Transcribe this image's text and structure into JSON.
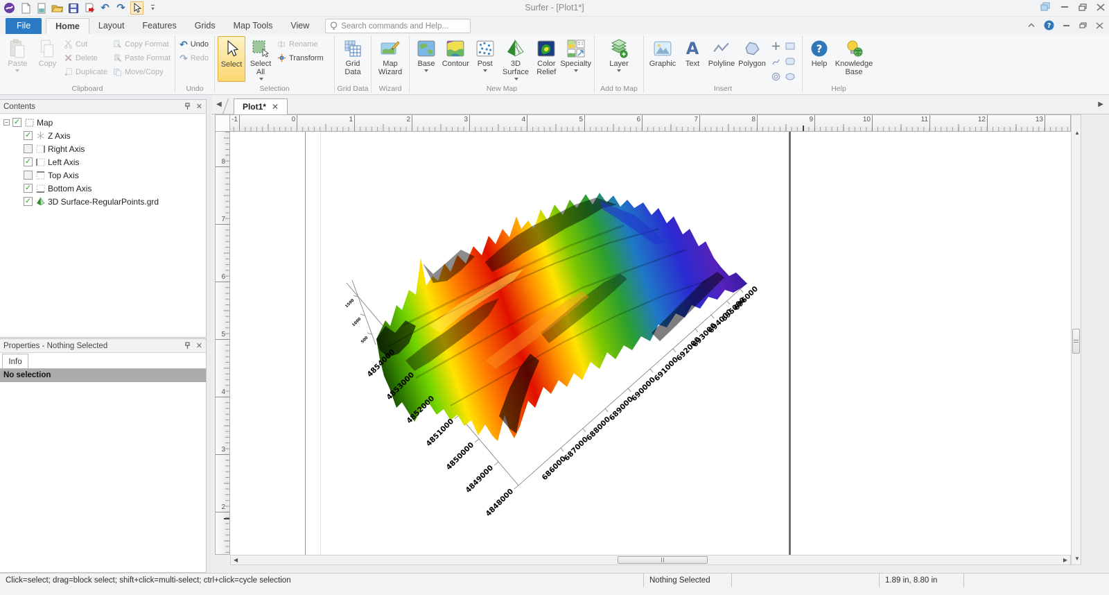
{
  "window": {
    "title": "Surfer - [Plot1*]"
  },
  "ribbon_tabs": {
    "file": "File",
    "home": "Home",
    "layout": "Layout",
    "features": "Features",
    "grids": "Grids",
    "map_tools": "Map Tools",
    "view": "View"
  },
  "search": {
    "placeholder": "Search commands and Help..."
  },
  "ribbon": {
    "clipboard": {
      "label": "Clipboard",
      "paste": "Paste",
      "copy": "Copy",
      "cut": "Cut",
      "delete": "Delete",
      "duplicate": "Duplicate",
      "copy_format": "Copy Format",
      "paste_format": "Paste Format",
      "move_copy": "Move/Copy"
    },
    "undo_group": {
      "label": "Undo",
      "undo": "Undo",
      "redo": "Redo"
    },
    "selection": {
      "label": "Selection",
      "select": "Select",
      "select_all": "Select All",
      "rename": "Rename",
      "transform": "Transform"
    },
    "grid_data": {
      "label": "Grid Data",
      "grid_data": "Grid Data"
    },
    "wizard": {
      "label": "Wizard",
      "map_wizard": "Map Wizard"
    },
    "new_map": {
      "label": "New Map",
      "base": "Base",
      "contour": "Contour",
      "post": "Post",
      "surface_3d": "3D Surface",
      "color_relief": "Color Relief",
      "specialty": "Specialty"
    },
    "add_to_map": {
      "label": "Add to Map",
      "layer": "Layer"
    },
    "insert": {
      "label": "Insert",
      "graphic": "Graphic",
      "text": "Text",
      "polyline": "Polyline",
      "polygon": "Polygon"
    },
    "help": {
      "label": "Help",
      "help": "Help",
      "knowledge_base": "Knowledge Base"
    }
  },
  "contents_panel": {
    "title": "Contents",
    "map": "Map",
    "z_axis": "Z Axis",
    "right_axis": "Right Axis",
    "left_axis": "Left Axis",
    "top_axis": "Top Axis",
    "bottom_axis": "Bottom Axis",
    "surface_layer": "3D Surface-RegularPoints.grd"
  },
  "properties_panel": {
    "title": "Properties - Nothing Selected",
    "tab": "Info",
    "message": "No selection"
  },
  "document": {
    "tab_label": "Plot1*",
    "h_ruler": [
      "-1",
      "0",
      "1",
      "2",
      "3",
      "4",
      "5",
      "6",
      "7",
      "8",
      "9",
      "10",
      "11",
      "12",
      "13"
    ],
    "v_ruler": [
      "8",
      "7",
      "6",
      "5",
      "4",
      "3",
      "2"
    ]
  },
  "map_plot": {
    "type": "3d-surface",
    "y_axis_labels": [
      "4854000",
      "4853000",
      "4852000",
      "4851000",
      "4850000",
      "4849000",
      "4848000"
    ],
    "x_axis_labels": [
      "686000",
      "687000",
      "688000",
      "689000",
      "690000",
      "691000",
      "692000",
      "693000",
      "694000",
      "695000",
      "696000"
    ],
    "z_axis_labels": [
      "1500",
      "1000",
      "500"
    ]
  },
  "status_bar": {
    "hint": "Click=select; drag=block select; shift+click=multi-select; ctrl+click=cycle selection",
    "selection": "Nothing Selected",
    "coordinates": "1.89 in, 8.80 in"
  }
}
